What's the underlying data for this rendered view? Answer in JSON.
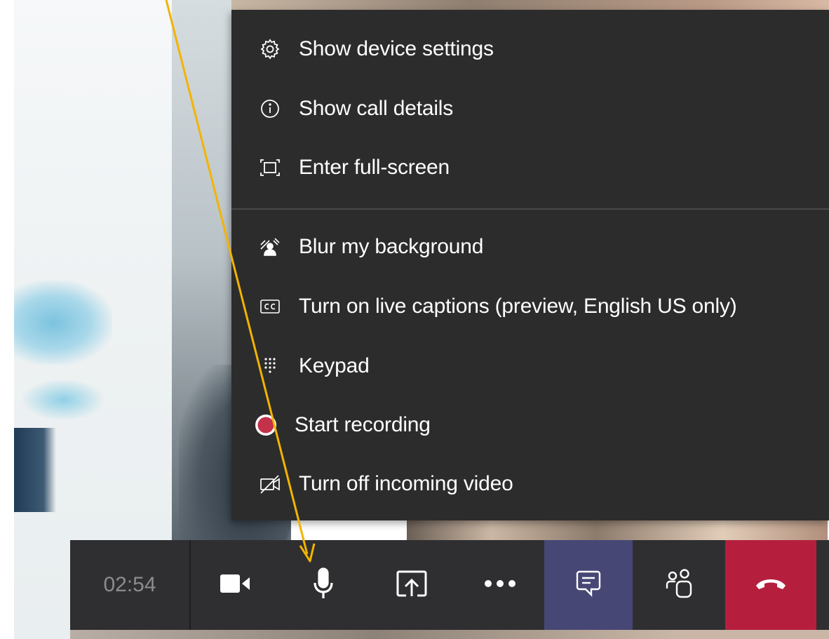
{
  "menu": {
    "items": [
      {
        "label": "Show device settings",
        "icon": "gear-icon"
      },
      {
        "label": "Show call details",
        "icon": "info-icon"
      },
      {
        "label": "Enter full-screen",
        "icon": "fullscreen-icon"
      },
      {
        "label": "Blur my background",
        "icon": "blur-background-icon"
      },
      {
        "label": "Turn on live captions (preview, English US only)",
        "icon": "closed-captions-icon"
      },
      {
        "label": "Keypad",
        "icon": "keypad-icon"
      },
      {
        "label": "Start recording",
        "icon": "record-icon"
      },
      {
        "label": "Turn off incoming video",
        "icon": "video-off-icon"
      }
    ]
  },
  "callbar": {
    "timer": "02:54",
    "buttons": [
      {
        "name": "camera",
        "icon": "camera-icon"
      },
      {
        "name": "microphone",
        "icon": "microphone-icon"
      },
      {
        "name": "share",
        "icon": "share-screen-icon"
      },
      {
        "name": "more",
        "icon": "more-options-icon"
      },
      {
        "name": "chat",
        "icon": "chat-icon"
      },
      {
        "name": "participants",
        "icon": "participants-icon"
      },
      {
        "name": "hangup",
        "icon": "hang-up-icon"
      }
    ]
  },
  "colors": {
    "menu_bg": "#2d2c2c",
    "callbar_bg": "#2f2f31",
    "chat_active": "#464775",
    "hangup": "#b51f3d",
    "record_red": "#c4314b",
    "annotation_arrow": "#f2b400"
  }
}
